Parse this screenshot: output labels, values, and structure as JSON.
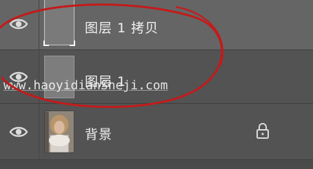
{
  "layers": [
    {
      "name": "图层 1 拷贝",
      "visible": true,
      "selected": true
    },
    {
      "name": "图层 1",
      "visible": true,
      "selected": false
    },
    {
      "name": "背景",
      "visible": true,
      "selected": false,
      "locked": true
    }
  ],
  "icons": {
    "visibility": "eye-icon",
    "lock": "lock-icon"
  },
  "watermark": "www.haoyidianSheji.com",
  "colors": {
    "panel_bg": "#535353",
    "selected_row_bg": "#656565",
    "annotation": "#c41a1a",
    "text": "#f0f0f0"
  }
}
